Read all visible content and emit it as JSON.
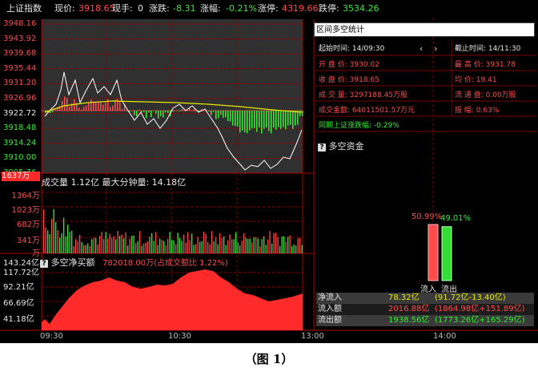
{
  "header": {
    "title": "上证指数",
    "price_label": "现价:",
    "price": "3918.65",
    "vol_label": "现手:",
    "vol": "0",
    "change_label": "涨跌:",
    "change": "-8.31",
    "pct_label": "涨幅:",
    "pct": "-0.21%",
    "limit_up_label": "涨停:",
    "limit_up": "4319.66",
    "limit_down_label": "跌停:",
    "limit_down": "3534.26"
  },
  "price_axis": [
    "3948.16",
    "3943.92",
    "3939.68",
    "3935.44",
    "3931.20",
    "3926.96",
    "3922.72",
    "3918.48",
    "3914.24",
    "3910.00",
    "3905.76"
  ],
  "volume_panel": {
    "current": "1637万",
    "label": "成交量 1.12亿 最大分钟量: 14.18亿",
    "axis": [
      "1364万",
      "1023万",
      "682万",
      "341万",
      "万"
    ]
  },
  "netbuy_panel": {
    "title": "多空净买额",
    "value": "782018.00万(占成交额比 1.22%)",
    "axis": [
      "143.24亿",
      "117.72亿",
      "92.21亿",
      "66.69亿",
      "41.18亿"
    ]
  },
  "time_axis": [
    "09:30",
    "10:30",
    "13:00",
    "14:00"
  ],
  "stats": {
    "title": "区间多空统计",
    "start_label": "起始时间:",
    "start": "14/09:30",
    "end_label": "截止时间:",
    "end": "14/11:30",
    "prev_icon": "chevron-left-icon",
    "next_icon": "chevron-right-icon",
    "open_label": "开 盘 价:",
    "open": "3930.02",
    "high_label": "最 高 价:",
    "high": "3931.78",
    "close_label": "收 盘 价:",
    "close": "3918.65",
    "avg_label": "均    价:",
    "avg": "19.41",
    "turnover_vol_label": "成 交 量:",
    "turnover_vol": "3297188.45万股",
    "float_label": "流 通 盘:",
    "float": "0.00万股",
    "turnover_amt_label": "成交金额:",
    "turnover_amt": "64011501.57万元",
    "amplitude_label": "振    幅:",
    "amplitude": "0.63%",
    "period_change_label": "同期上证涨跌幅:",
    "period_change": "-0.29%"
  },
  "bullbear": {
    "title": "多空资金",
    "inflow_pct": "50.99%",
    "outflow_pct": "49.01%",
    "inflow_label": "流入",
    "outflow_label": "流出",
    "inflow_share": 0.5099,
    "outflow_share": 0.4901
  },
  "flows": [
    {
      "label": "净流入",
      "value": "78.32亿",
      "detail": "(91.72亿-13.40亿)"
    },
    {
      "label": "流入额",
      "value": "2016.88亿",
      "detail": "(1864.98亿+151.89亿)"
    },
    {
      "label": "流出额",
      "value": "1938.56亿",
      "detail": "(1773.26亿+165.29亿)"
    }
  ],
  "caption": "（图 1）",
  "colors": {
    "up": "#ff4b4b",
    "down": "#33ee33",
    "price_line": "#ffffff",
    "avg_line": "#e8e800",
    "grid": "#8b0000"
  }
}
